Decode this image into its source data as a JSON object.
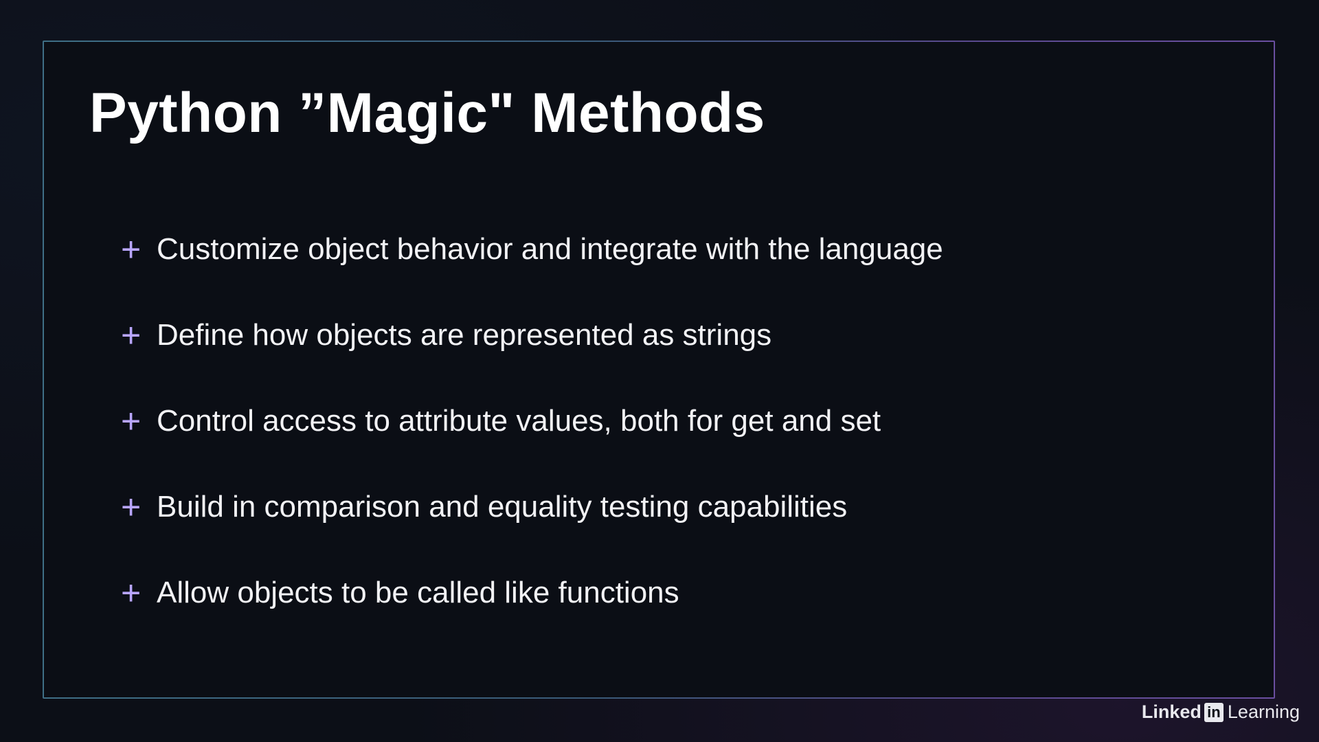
{
  "slide": {
    "title": "Python ”Magic\" Methods",
    "bullets": [
      {
        "icon": "plus-icon",
        "text": "Customize object behavior and integrate with the language"
      },
      {
        "icon": "plus-icon",
        "text": "Define how objects are represented as strings"
      },
      {
        "icon": "plus-icon",
        "text": "Control access to attribute values, both for get and set"
      },
      {
        "icon": "plus-icon",
        "text": "Build in comparison and equality testing capabilities"
      },
      {
        "icon": "plus-icon",
        "text": "Allow objects to be called like functions"
      }
    ],
    "bullet_glyph": "+"
  },
  "brand": {
    "part1": "Linked",
    "part2": "in",
    "part3": "Learning"
  },
  "colors": {
    "background": "#0c0f17",
    "bullet_accent": "#b9a6ff",
    "frame_start": "#3f6f86",
    "frame_end": "#6a4fa0"
  }
}
